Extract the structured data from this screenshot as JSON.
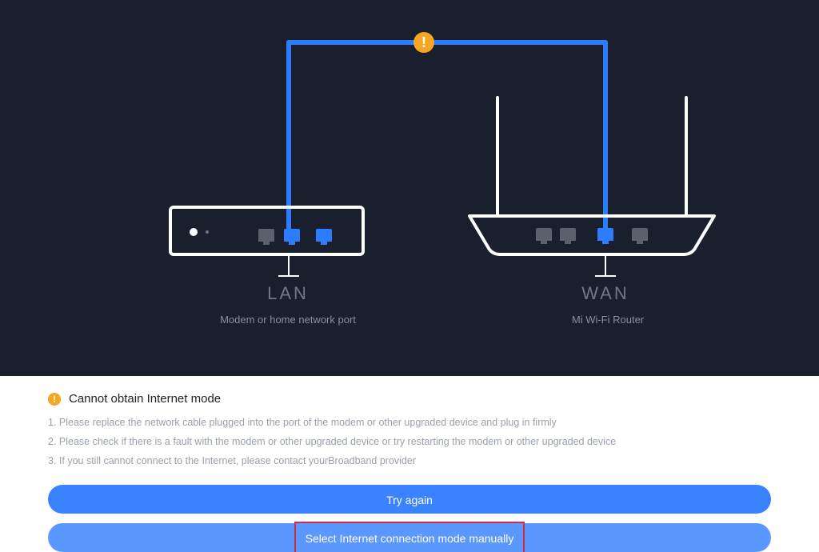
{
  "diagram": {
    "warning_badge": "!",
    "lan_label": "LAN",
    "modem_caption": "Modem or home network port",
    "wan_label": "WAN",
    "router_caption": "Mi Wi-Fi Router"
  },
  "error": {
    "icon": "!",
    "title": "Cannot obtain Internet mode",
    "steps": [
      "1. Please replace the network cable plugged into the port of the modem or other upgraded device and plug in firmly",
      "2. Please check if there is a fault with the modem or other upgraded device or try restarting the modem or other upgraded device",
      "3. If you still cannot connect to the Internet, please contact yourBroadband provider"
    ]
  },
  "buttons": {
    "try_again": "Try again",
    "select_manually": "Select Internet connection mode manually"
  },
  "colors": {
    "accent": "#2b7cff",
    "warning": "#f5a623",
    "highlight": "#d12b3f"
  }
}
